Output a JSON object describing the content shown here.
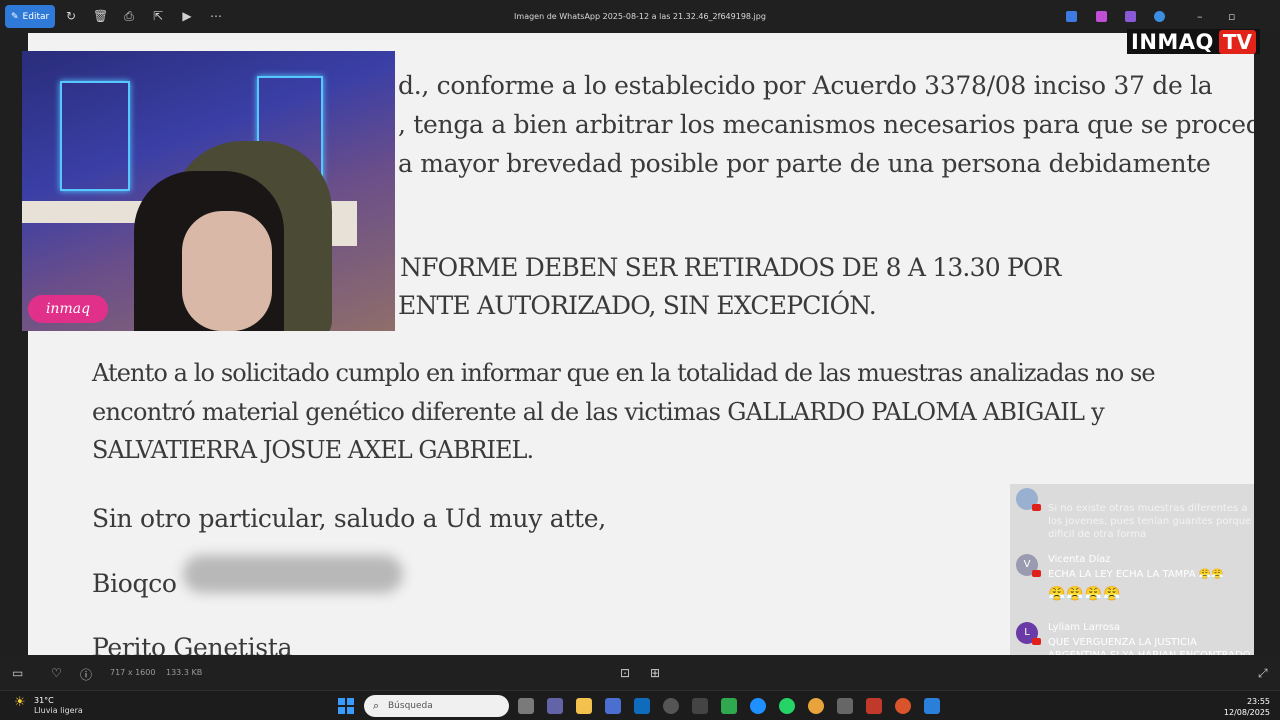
{
  "toolbar": {
    "edit_label": "Editar",
    "file_title": "Imagen de WhatsApp 2025-08-12 a las 21.32.46_2f649198.jpg"
  },
  "logo": {
    "brand": "INMAQ",
    "tv": "TV"
  },
  "document": {
    "lines": [
      "d., conforme a lo establecido por Acuerdo 3378/08 inciso 37 de la",
      ", tenga a bien arbitrar los mecanismos necesarios para que se proceda",
      "a mayor brevedad posible por parte de una persona debidamente",
      "NFORME DEBEN SER RETIRADOS DE 8 A 13.30 POR",
      "ENTE AUTORIZADO, SIN EXCEPCIÓN.",
      "Atento a lo solicitado cumplo en informar que en la totalidad de las muestras analizadas no se",
      "encontró material genético diferente al de las victimas GALLARDO PALOMA ABIGAIL y",
      "SALVATIERRA JOSUE AXEL GABRIEL.",
      "Sin otro particular, saludo a Ud muy atte,",
      "Bioqco",
      "Perito Genetista"
    ]
  },
  "webcam": {
    "badge": "inmaq"
  },
  "chat": {
    "messages": [
      {
        "author": "",
        "initial": "",
        "text": "Si no existe otras muestras diferentes a los jovenes, pues tenían guantes porque dificil de otra forma"
      },
      {
        "author": "Vicenta Díaz",
        "initial": "V",
        "text": "ECHA LA LEY ECHA LA TAMPA 😤😤",
        "emojis": "😤😤😤😤"
      },
      {
        "author": "Lyliam Larrosa",
        "initial": "L",
        "text": "QUE VERGUENZA LA JUSTICIA ARGENTINA SI YA HABIAN ENCONTRADO EL TERCER ADN QUIEREN TAPAR TODO PORQUE SERA"
      }
    ]
  },
  "viewer_bottom": {
    "dimensions": "717 x 1600",
    "size": "133.3 KB"
  },
  "taskbar": {
    "temp": "31°C",
    "weather": "Lluvia ligera",
    "search_placeholder": "Búsqueda",
    "time": "23:55",
    "date": "12/08/2025"
  },
  "colors": {
    "accent": "#2f7ad9",
    "logo_red": "#e2231a",
    "badge_pink": "#e0308a"
  }
}
